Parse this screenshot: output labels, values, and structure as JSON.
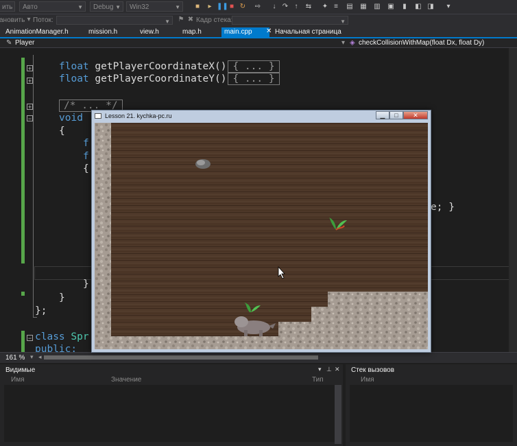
{
  "toolbar": {
    "solution_platform_prefix": "ить",
    "config_auto": "Авто",
    "config_debug": "Debug",
    "config_platform": "Win32",
    "icons": [
      "play-icon",
      "pause-icon",
      "stop-icon",
      "restart-icon",
      "step-into-icon",
      "step-over-icon",
      "step-out-icon",
      "breakpoint-icon",
      "bookmark-icon"
    ]
  },
  "toolbar2": {
    "stop_label": "ановить",
    "thread_label": "Поток:",
    "stackframe_label": "Кадр стека:"
  },
  "tabs": [
    {
      "label": "AnimationManager.h"
    },
    {
      "label": "mission.h"
    },
    {
      "label": "view.h"
    },
    {
      "label": "map.h"
    },
    {
      "label": "main.cpp",
      "active": true
    },
    {
      "label": "Начальная страница"
    }
  ],
  "navbar": {
    "scope": "Player",
    "member": "checkCollisionWithMap(float Dx, float Dy)"
  },
  "code": {
    "line1_type": "float",
    "line1_name": "getPlayerCoordinateX()",
    "line2_type": "float",
    "line2_name": "getPlayerCoordinateY()",
    "collapsed_body": "{ ... }",
    "collapsed_comment": "/* ... */",
    "void_kw": "void",
    "brace_open": "{",
    "frag_f1": "f",
    "frag_f2": "f",
    "frag_brace": "{",
    "frag_right": "e; }",
    "inner_close": "}",
    "outer_close": "}",
    "class_close": "};",
    "class_kw": "class",
    "class_name": "Spr",
    "public_kw": "public:"
  },
  "zoom": "161 %",
  "panels": {
    "locals_title": "Видимые",
    "locals_cols": [
      "Имя",
      "Значение",
      "Тип"
    ],
    "callstack_title": "Стек вызовов",
    "callstack_cols": [
      "Имя"
    ]
  },
  "game": {
    "title": "Lesson 21. kychka-pc.ru",
    "colors": {
      "wood": "#4e3829",
      "stone": "#a69c93"
    }
  }
}
